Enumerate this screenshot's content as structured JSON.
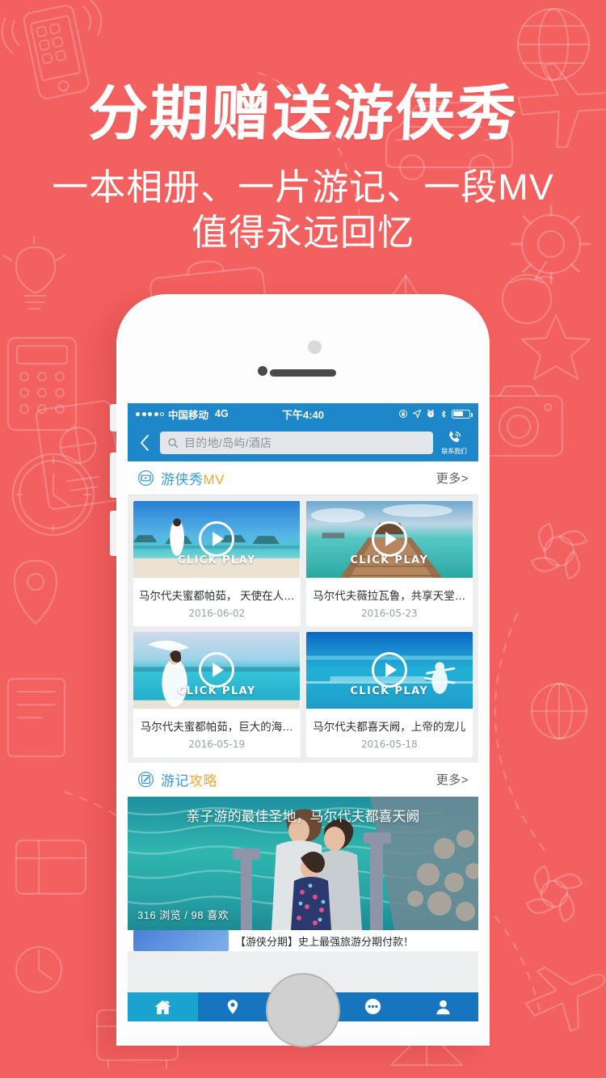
{
  "promo": {
    "headline": "分期赠送游侠秀",
    "subline1": "一本相册、一片游记、一段MV",
    "subline2": "值得永远回忆",
    "bg_color": "#f2605f"
  },
  "phone": {
    "statusbar": {
      "carrier": "中国移动",
      "network": "4G",
      "time": "下午4:40",
      "icons": [
        "rotation-lock-icon",
        "location-arrow-icon",
        "alarm-clock-icon",
        "bluetooth-icon",
        "battery-icon"
      ]
    },
    "navbar": {
      "back_icon": "chevron-left-icon",
      "search_placeholder": "目的地/岛屿/酒店",
      "search_value": "",
      "search_icon": "search-icon",
      "contact_label": "联系我们",
      "contact_icon": "phone-icon",
      "bg_color": "#1e87c9"
    },
    "sections": [
      {
        "id": "mv",
        "icon": "film-frame-icon",
        "title_primary": "游侠秀",
        "title_accent": "MV",
        "more_label": "更多>",
        "videos": [
          {
            "title": "马尔代夫蜜都帕茹， 天使在人…",
            "date": "2016-06-02",
            "overlay_label": "CLICK PLAY",
            "play_icon": "play-circle-icon"
          },
          {
            "title": "马尔代夫薇拉瓦鲁，共享天堂…",
            "date": "2016-05-23",
            "overlay_label": "CLICK PLAY",
            "play_icon": "play-circle-icon"
          },
          {
            "title": "马尔代夫蜜都帕茹，巨大的海…",
            "date": "2016-05-19",
            "overlay_label": "CLICK PLAY",
            "play_icon": "play-circle-icon"
          },
          {
            "title": "马尔代夫都喜天阙，上帝的宠儿",
            "date": "2016-05-18",
            "overlay_label": "CLICK PLAY",
            "play_icon": "play-circle-icon"
          }
        ]
      },
      {
        "id": "notes",
        "icon": "pen-edit-icon",
        "title_primary": "游记",
        "title_accent": "攻略",
        "more_label": "更多>",
        "feature": {
          "title": "亲子游的最佳圣地，马尔代夫都喜天阙",
          "stats": "316 浏览 / 98 喜欢"
        },
        "next_item": {
          "text": "【游侠分期】史上最强旅游分期付款！"
        }
      }
    ],
    "tabbar": {
      "items": [
        {
          "name": "home",
          "icon": "home-icon",
          "active": true
        },
        {
          "name": "destination",
          "icon": "location-pin-icon",
          "active": false
        },
        {
          "name": "favorites",
          "icon": "star-icon",
          "active": false
        },
        {
          "name": "messages",
          "icon": "chat-bubble-icon",
          "active": false
        },
        {
          "name": "profile",
          "icon": "person-icon",
          "active": false
        }
      ],
      "bg_color": "#1675be",
      "active_color": "#1aa3cf"
    }
  }
}
